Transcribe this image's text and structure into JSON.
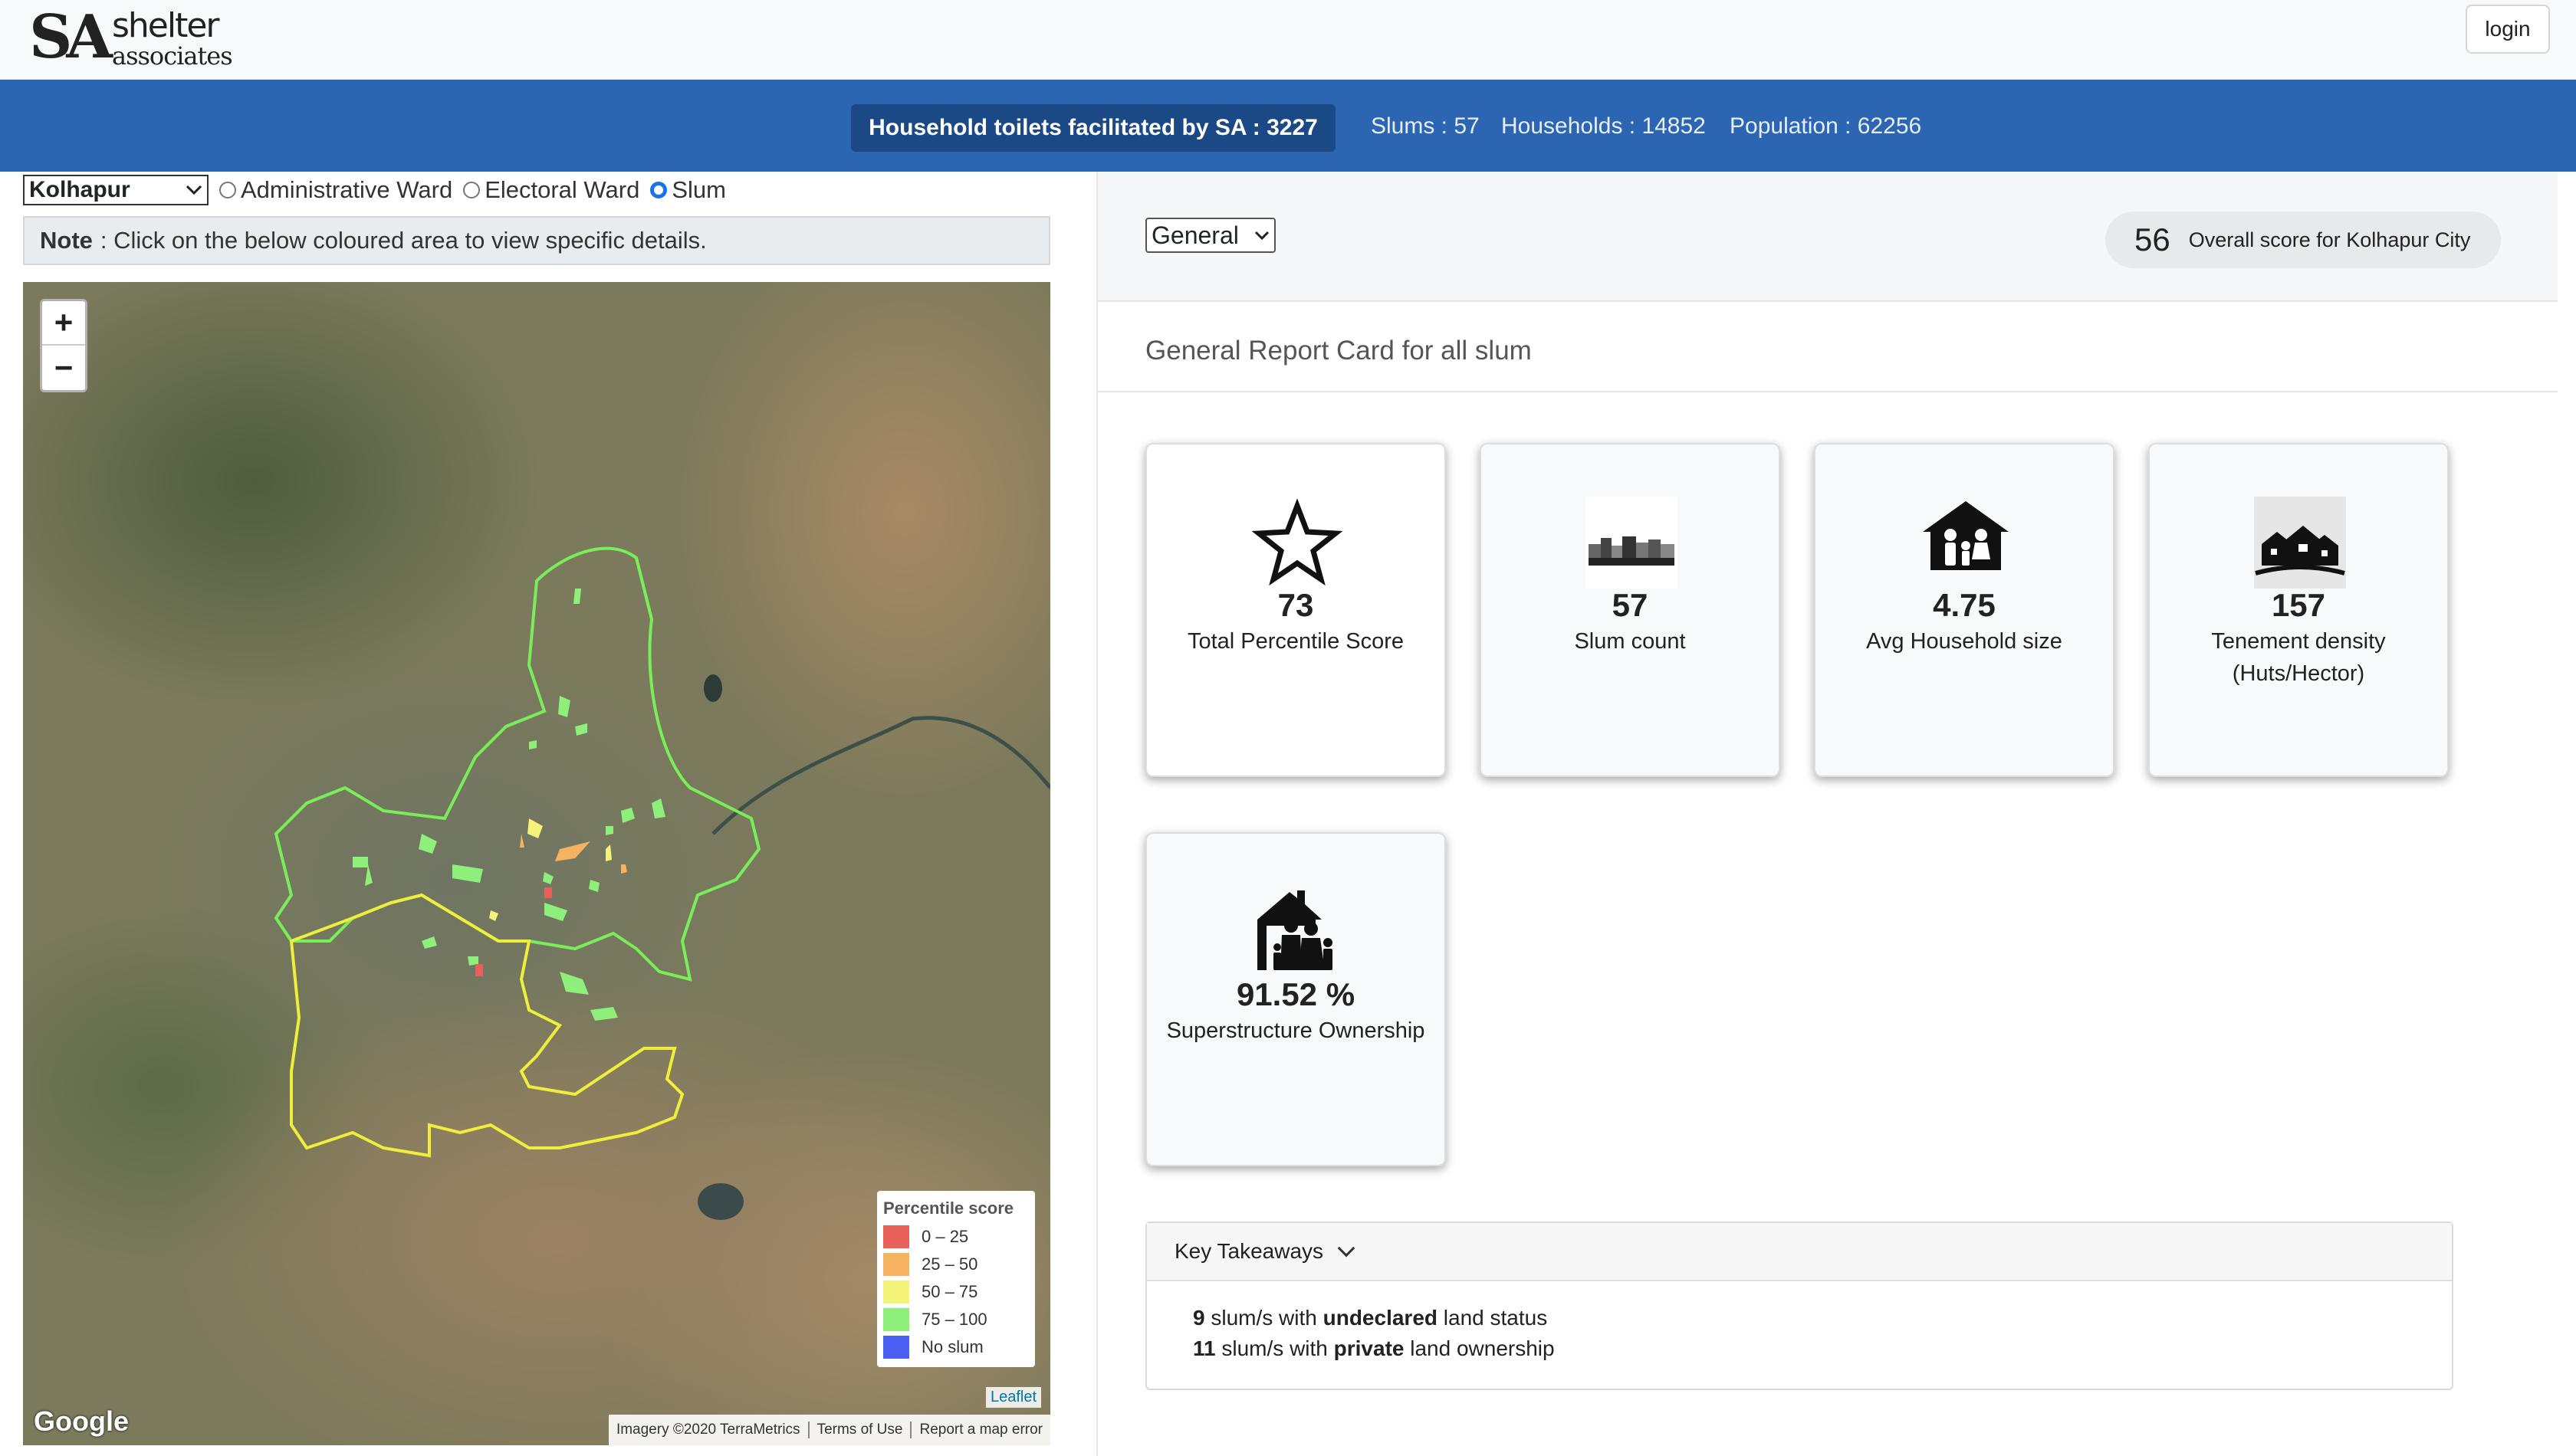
{
  "header": {
    "logo": {
      "mark": "SA",
      "line1": "shelter",
      "line2": "associates"
    },
    "login_label": "login"
  },
  "stats": {
    "toilets": "Household toilets facilitated by SA : 3227",
    "slums": "Slums : 57",
    "households": "Households : 14852",
    "population": "Population : 62256"
  },
  "filters": {
    "city": "Kolhapur",
    "radios": [
      {
        "label": "Administrative Ward",
        "checked": false
      },
      {
        "label": "Electoral Ward",
        "checked": false
      },
      {
        "label": "Slum",
        "checked": true
      }
    ],
    "note_label": "Note",
    "note_text": ": Click on the below coloured area to view specific details."
  },
  "map": {
    "zoom_in": "+",
    "zoom_out": "−",
    "legend_title": "Percentile score",
    "legend": [
      {
        "label": "0 – 25",
        "color": "#e8605a"
      },
      {
        "label": "25 – 50",
        "color": "#f5b361"
      },
      {
        "label": "50 – 75",
        "color": "#f5f27a"
      },
      {
        "label": "75 – 100",
        "color": "#8ef07a"
      },
      {
        "label": "No slum",
        "color": "#4a5ef0"
      }
    ],
    "google": "Google",
    "leaflet": "Leaflet",
    "attribution": [
      "Imagery ©2020 TerraMetrics",
      "Terms of Use",
      "Report a map error"
    ]
  },
  "report": {
    "category": "General",
    "overall_score": "56",
    "overall_label": "Overall score for Kolhapur City",
    "title": "General Report Card for all slum",
    "cards": [
      {
        "value": "73",
        "label": "Total Percentile Score",
        "icon": "star-icon"
      },
      {
        "value": "57",
        "label": "Slum count",
        "icon": "city-skyline-icon"
      },
      {
        "value": "4.75",
        "label": "Avg Household size",
        "icon": "family-house-icon"
      },
      {
        "value": "157",
        "label": "Tenement density (Huts/Hector)",
        "icon": "houses-icon"
      },
      {
        "value": "91.52 %",
        "label": "Superstructure Ownership",
        "icon": "family-home-icon"
      }
    ],
    "takeaways_title": "Key Takeaways",
    "takeaways": [
      {
        "count": "9",
        "pre": "slum/s with",
        "bold": "undeclared",
        "post": "land status"
      },
      {
        "count": "11",
        "pre": "slum/s with",
        "bold": "private",
        "post": "land ownership"
      }
    ]
  }
}
